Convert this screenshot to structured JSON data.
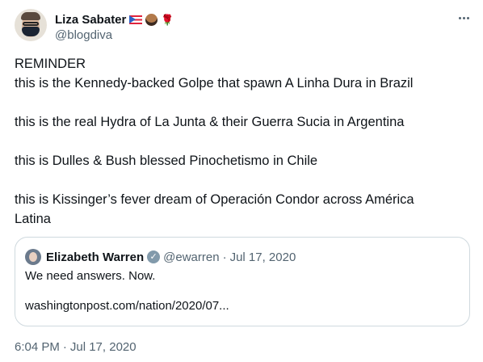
{
  "author": {
    "display_name": "Liza Sabater",
    "handle": "@blogdiva",
    "name_emoji": [
      "puerto-rico-flag",
      "person-emoji",
      "rose-emoji"
    ]
  },
  "tweet": {
    "lines": [
      "REMINDER",
      "this is the Kennedy-backed Golpe that spawn A Linha Dura in Brazil",
      "",
      "this is the real Hydra of La Junta & their Guerra Sucia in Argentina",
      "",
      "this is Dulles & Bush blessed Pinochetismo in Chile",
      "",
      "this is Kissinger’s fever dream of Operación Condor across América",
      "Latina"
    ],
    "time": "6:04 PM",
    "separator": "·",
    "date": "Jul 17, 2020"
  },
  "quoted": {
    "display_name": "Elizabeth Warren",
    "handle": "@ewarren",
    "separator": "·",
    "date": "Jul 17, 2020",
    "text": "We need answers. Now.",
    "link": "washingtonpost.com/nation/2020/07..."
  },
  "icons": {
    "more": "more-horizontal-icon",
    "verified": "verified-badge-icon"
  },
  "colors": {
    "text": "#0f1419",
    "secondary": "#536471",
    "border": "#cfd9de",
    "verified_badge": "#829aab"
  }
}
